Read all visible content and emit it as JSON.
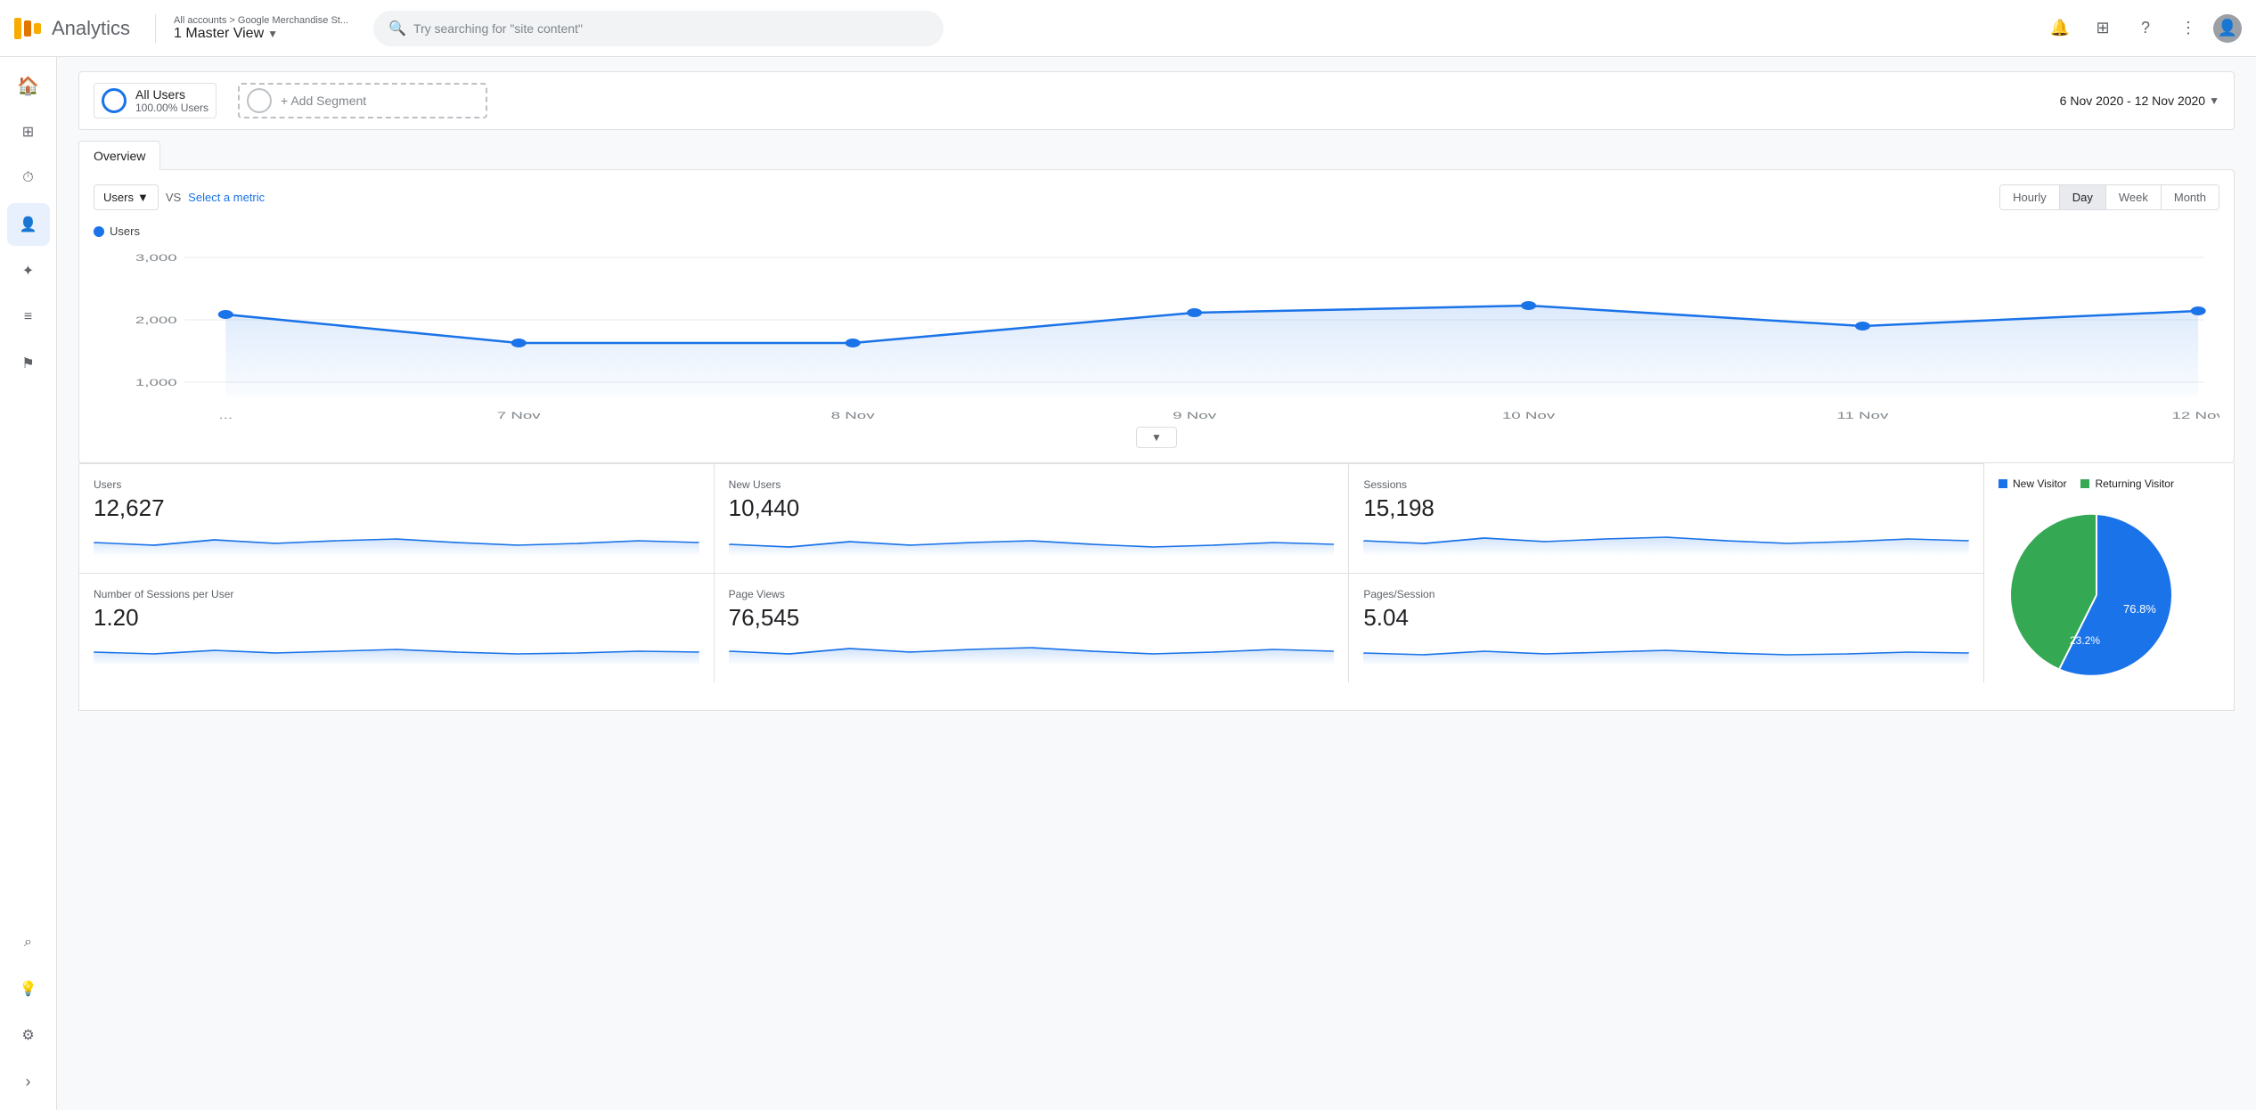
{
  "app": {
    "title": "Analytics",
    "logo_bars": [
      "#f9ab00",
      "#e37400",
      "#f9ab00"
    ]
  },
  "header": {
    "breadcrumb_top": "All accounts > Google Merchandise St...",
    "breadcrumb_main": "1 Master View",
    "search_placeholder": "Try searching for \"site content\""
  },
  "sidebar": {
    "items": [
      {
        "id": "home",
        "icon": "🏠",
        "label": "Home",
        "active": false
      },
      {
        "id": "customization",
        "icon": "⊞",
        "label": "Customization",
        "active": false
      },
      {
        "id": "realtime",
        "icon": "⏱",
        "label": "Real-time",
        "active": false
      },
      {
        "id": "audience",
        "icon": "👤",
        "label": "Audience",
        "active": true
      },
      {
        "id": "acquisition",
        "icon": "✦",
        "label": "Acquisition",
        "active": false
      },
      {
        "id": "behavior",
        "icon": "≡",
        "label": "Behavior",
        "active": false
      },
      {
        "id": "conversions",
        "icon": "⚑",
        "label": "Conversions",
        "active": false
      }
    ],
    "bottom_items": [
      {
        "id": "search2",
        "icon": "⌕",
        "label": "Search"
      },
      {
        "id": "lightbulb",
        "icon": "💡",
        "label": "Insights"
      },
      {
        "id": "settings",
        "icon": "⚙",
        "label": "Settings"
      },
      {
        "id": "expand",
        "icon": "›",
        "label": "Expand"
      }
    ]
  },
  "segment": {
    "all_users_label": "All Users",
    "all_users_sub": "100.00% Users",
    "add_segment_label": "+ Add Segment"
  },
  "date_range": {
    "label": "6 Nov 2020 - 12 Nov 2020"
  },
  "overview_tab": "Overview",
  "metric_controls": {
    "primary_metric": "Users",
    "vs_label": "VS",
    "select_metric_label": "Select a metric",
    "time_buttons": [
      "Hourly",
      "Day",
      "Week",
      "Month"
    ],
    "active_time": "Day"
  },
  "chart": {
    "legend_label": "Users",
    "y_labels": [
      "3,000",
      "2,000",
      "1,000"
    ],
    "x_labels": [
      "...",
      "7 Nov",
      "8 Nov",
      "9 Nov",
      "10 Nov",
      "11 Nov",
      "12 Nov"
    ],
    "data_points": [
      {
        "x": 0.02,
        "y": 0.4
      },
      {
        "x": 0.165,
        "y": 0.62
      },
      {
        "x": 0.33,
        "y": 0.62
      },
      {
        "x": 0.5,
        "y": 0.44
      },
      {
        "x": 0.665,
        "y": 0.38
      },
      {
        "x": 0.83,
        "y": 0.55
      },
      {
        "x": 0.99,
        "y": 0.42
      }
    ]
  },
  "metrics": [
    {
      "label": "Users",
      "value": "12,627",
      "sparkline_values": [
        40,
        38,
        42,
        39,
        41,
        43,
        40,
        38,
        39,
        41
      ]
    },
    {
      "label": "New Users",
      "value": "10,440",
      "sparkline_values": [
        38,
        36,
        40,
        37,
        39,
        41,
        38,
        36,
        37,
        39
      ]
    },
    {
      "label": "Sessions",
      "value": "15,198",
      "sparkline_values": [
        42,
        40,
        44,
        41,
        43,
        45,
        42,
        40,
        41,
        43
      ]
    }
  ],
  "metrics_row2": [
    {
      "label": "Number of Sessions per User",
      "value": "1.20",
      "sparkline_values": [
        15,
        14,
        15,
        14,
        15,
        16,
        15,
        14,
        14,
        15
      ]
    },
    {
      "label": "Page Views",
      "value": "76,545",
      "sparkline_values": [
        42,
        40,
        44,
        41,
        43,
        45,
        42,
        40,
        41,
        43
      ]
    },
    {
      "label": "Pages/Session",
      "value": "5.04",
      "sparkline_values": [
        14,
        13,
        14,
        13,
        14,
        15,
        14,
        13,
        13,
        14
      ]
    }
  ],
  "pie_chart": {
    "legend_items": [
      {
        "label": "New Visitor",
        "color": "#1a73e8",
        "class": "blue"
      },
      {
        "label": "Returning Visitor",
        "color": "#34a853",
        "class": "green"
      }
    ],
    "new_visitor_pct": 76.8,
    "returning_visitor_pct": 23.2,
    "new_visitor_label": "76.8%",
    "returning_visitor_label": "23.2%"
  }
}
